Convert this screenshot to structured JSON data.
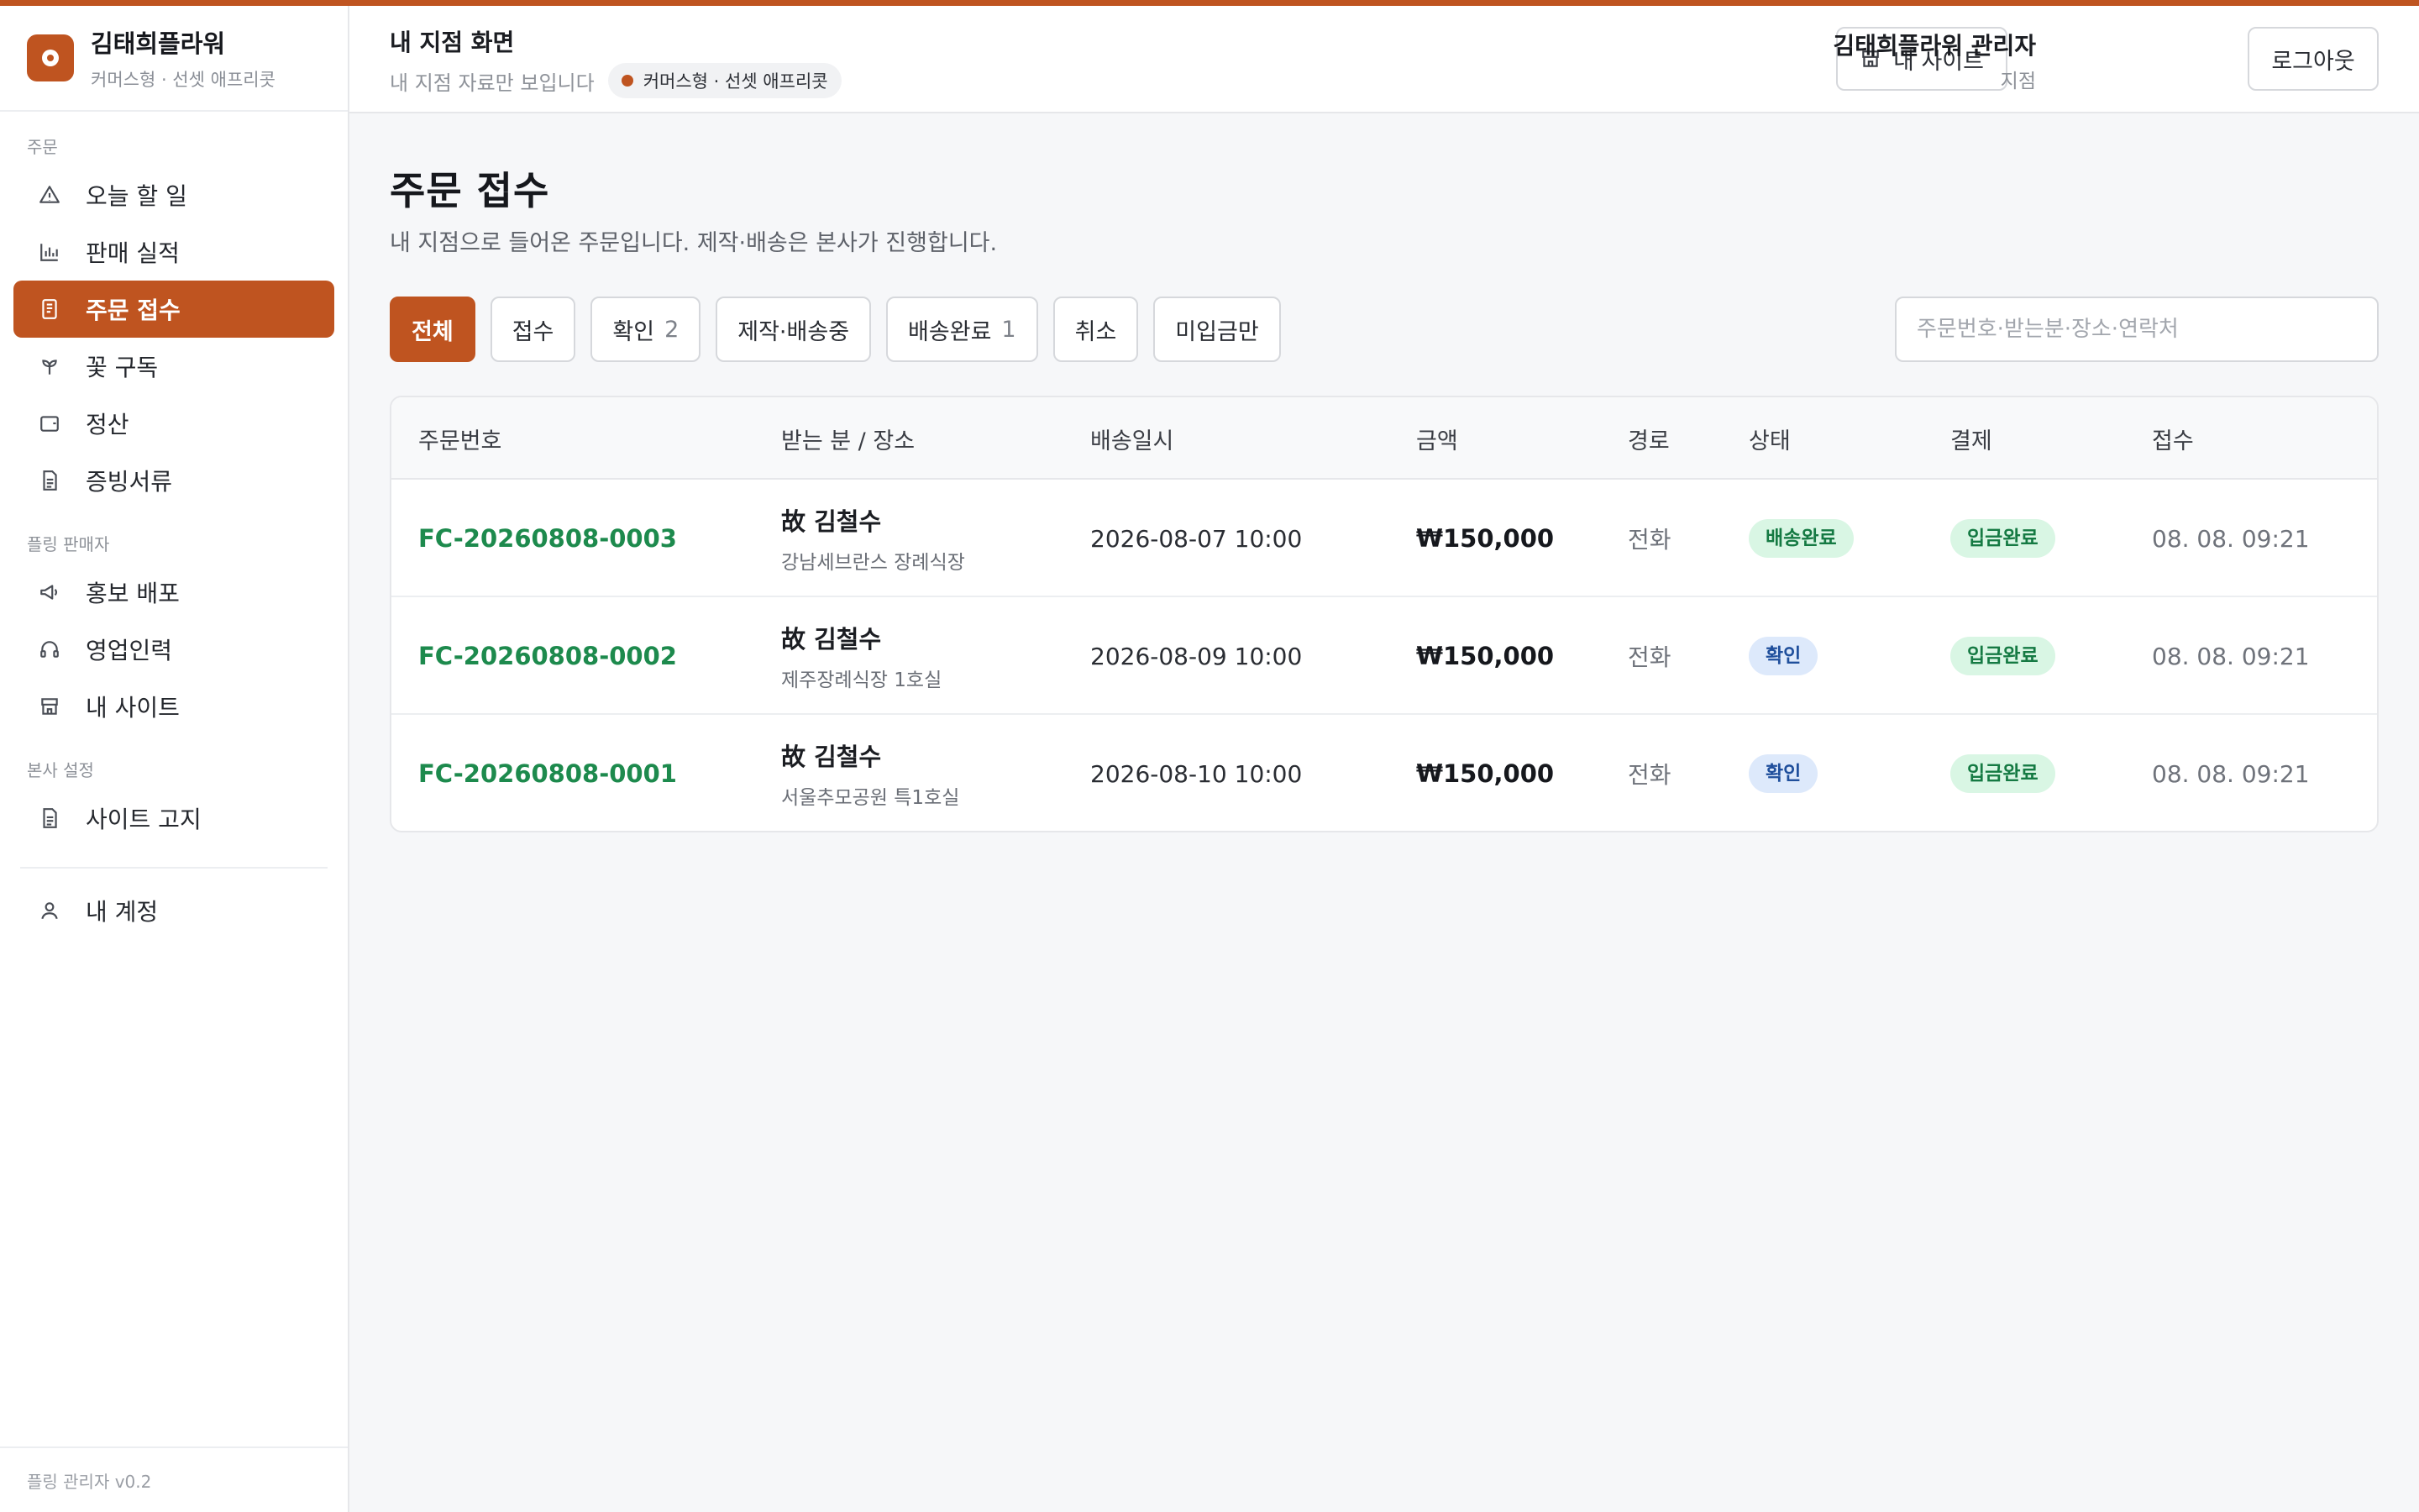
{
  "brand": {
    "name": "김태희플라워",
    "subtitle": "커머스형 · 선셋 애프리콧"
  },
  "sidebar": {
    "sections": {
      "order": "주문",
      "seller": "플링 판매자",
      "hq": "본사 설정"
    },
    "items": [
      {
        "label": "오늘 할 일",
        "icon": "alert-triangle-icon"
      },
      {
        "label": "판매 실적",
        "icon": "bar-chart-icon"
      },
      {
        "label": "주문 접수",
        "icon": "receipt-icon",
        "active": true
      },
      {
        "label": "꽃 구독",
        "icon": "sprout-icon"
      },
      {
        "label": "정산",
        "icon": "wallet-icon"
      },
      {
        "label": "증빙서류",
        "icon": "document-icon"
      },
      {
        "label": "홍보 배포",
        "icon": "megaphone-icon"
      },
      {
        "label": "영업인력",
        "icon": "headset-icon"
      },
      {
        "label": "내 사이트",
        "icon": "store-icon"
      },
      {
        "label": "사이트 고지",
        "icon": "document-icon"
      },
      {
        "label": "내 계정",
        "icon": "user-icon"
      }
    ],
    "footer": "플링 관리자 v0.2"
  },
  "header": {
    "title": "내 지점 화면",
    "subtitle": "내 지점 자료만 보입니다",
    "shop_chip": "커머스형 · 선셋 애프리콧",
    "my_site_button": "내 사이트",
    "admin_name": "김태희플라워 관리자",
    "admin_role": "지점",
    "logout_button": "로그아웃"
  },
  "page": {
    "title": "주문 접수",
    "description": "내 지점으로 들어온 주문입니다. 제작·배송은 본사가 진행합니다."
  },
  "filters": [
    {
      "label": "전체",
      "count": "",
      "active": true
    },
    {
      "label": "접수",
      "count": ""
    },
    {
      "label": "확인",
      "count": "2"
    },
    {
      "label": "제작·배송중",
      "count": ""
    },
    {
      "label": "배송완료",
      "count": "1"
    },
    {
      "label": "취소",
      "count": ""
    },
    {
      "label": "미입금만",
      "count": ""
    }
  ],
  "search": {
    "placeholder": "주문번호·받는분·장소·연락처",
    "value": ""
  },
  "table": {
    "columns": [
      "주문번호",
      "받는 분 / 장소",
      "배송일시",
      "금액",
      "경로",
      "상태",
      "결제",
      "접수"
    ],
    "rows": [
      {
        "order_no": "FC-20260808-0003",
        "recipient": "故 김철수",
        "place": "강남세브란스 장례식장",
        "delivery": "2026-08-07 10:00",
        "amount": "₩150,000",
        "channel": "전화",
        "status": "배송완료",
        "payment": "입금완료",
        "received": "08. 08. 09:21"
      },
      {
        "order_no": "FC-20260808-0002",
        "recipient": "故 김철수",
        "place": "제주장례식장 1호실",
        "delivery": "2026-08-09 10:00",
        "amount": "₩150,000",
        "channel": "전화",
        "status": "확인",
        "payment": "입금완료",
        "received": "08. 08. 09:21"
      },
      {
        "order_no": "FC-20260808-0001",
        "recipient": "故 김철수",
        "place": "서울추모공원 특1호실",
        "delivery": "2026-08-10 10:00",
        "amount": "₩150,000",
        "channel": "전화",
        "status": "확인",
        "payment": "입금완료",
        "received": "08. 08. 09:21"
      }
    ]
  },
  "colors": {
    "accent": "#bf5420",
    "link_green": "#1d8a4d",
    "badge_green_bg": "#d9f6e4",
    "badge_blue_bg": "#dde9fb"
  }
}
